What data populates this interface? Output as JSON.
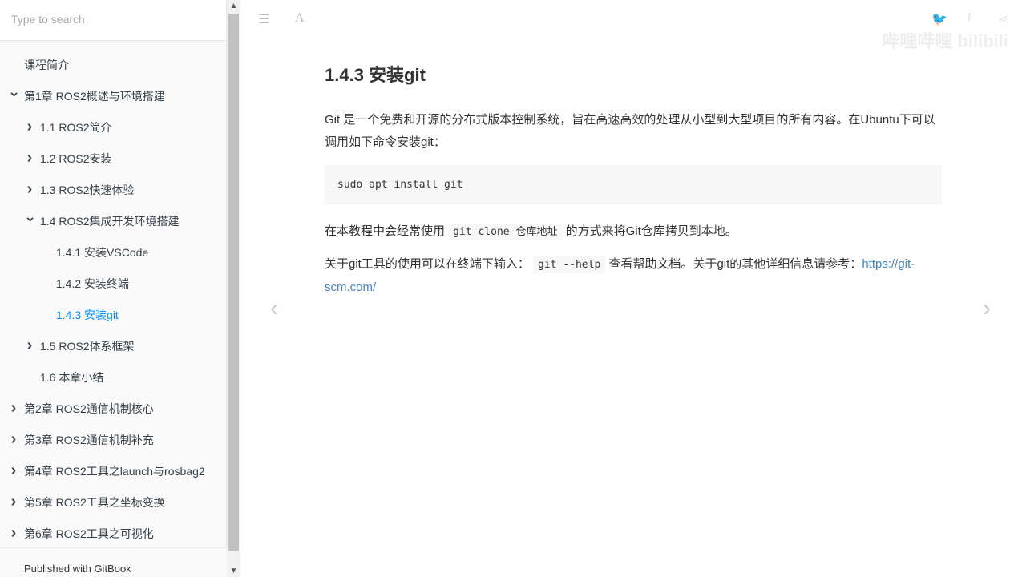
{
  "search": {
    "placeholder": "Type to search"
  },
  "toc": [
    {
      "label": "课程简介",
      "level": 0,
      "chev": ""
    },
    {
      "label": "第1章 ROS2概述与环境搭建",
      "level": 0,
      "chev": "down"
    },
    {
      "label": "1.1 ROS2简介",
      "level": 1,
      "chev": "right"
    },
    {
      "label": "1.2 ROS2安装",
      "level": 1,
      "chev": "right"
    },
    {
      "label": "1.3 ROS2快速体验",
      "level": 1,
      "chev": "right"
    },
    {
      "label": "1.4 ROS2集成开发环境搭建",
      "level": 1,
      "chev": "down"
    },
    {
      "label": "1.4.1 安装VSCode",
      "level": 2,
      "chev": ""
    },
    {
      "label": "1.4.2 安装终端",
      "level": 2,
      "chev": ""
    },
    {
      "label": "1.4.3 安装git",
      "level": 2,
      "chev": "",
      "active": true
    },
    {
      "label": "1.5 ROS2体系框架",
      "level": 1,
      "chev": "right"
    },
    {
      "label": "1.6 本章小结",
      "level": 1,
      "chev": ""
    },
    {
      "label": "第2章 ROS2通信机制核心",
      "level": 0,
      "chev": "right"
    },
    {
      "label": "第3章 ROS2通信机制补充",
      "level": 0,
      "chev": "right"
    },
    {
      "label": "第4章 ROS2工具之launch与rosbag2",
      "level": 0,
      "chev": "right"
    },
    {
      "label": "第5章 ROS2工具之坐标变换",
      "level": 0,
      "chev": "right"
    },
    {
      "label": "第6章 ROS2工具之可视化",
      "level": 0,
      "chev": "right"
    }
  ],
  "footer": "Published with GitBook",
  "page": {
    "title": "1.4.3 安装git",
    "p1": "Git 是一个免费和开源的分布式版本控制系统，旨在高速高效的处理从小型到大型项目的所有内容。在Ubuntu下可以调用如下命令安装git：",
    "code": "sudo apt install git",
    "p2_a": "在本教程中会经常使用 ",
    "p2_code": "git clone 仓库地址",
    "p2_b": " 的方式来将Git仓库拷贝到本地。",
    "p3_a": "关于git工具的使用可以在终端下输入： ",
    "p3_code": "git --help",
    "p3_b": " 查看帮助文档。关于git的其他详细信息请参考：",
    "link": "https://git-scm.com/"
  },
  "watermark": "哔哩哔哩 bilibili"
}
